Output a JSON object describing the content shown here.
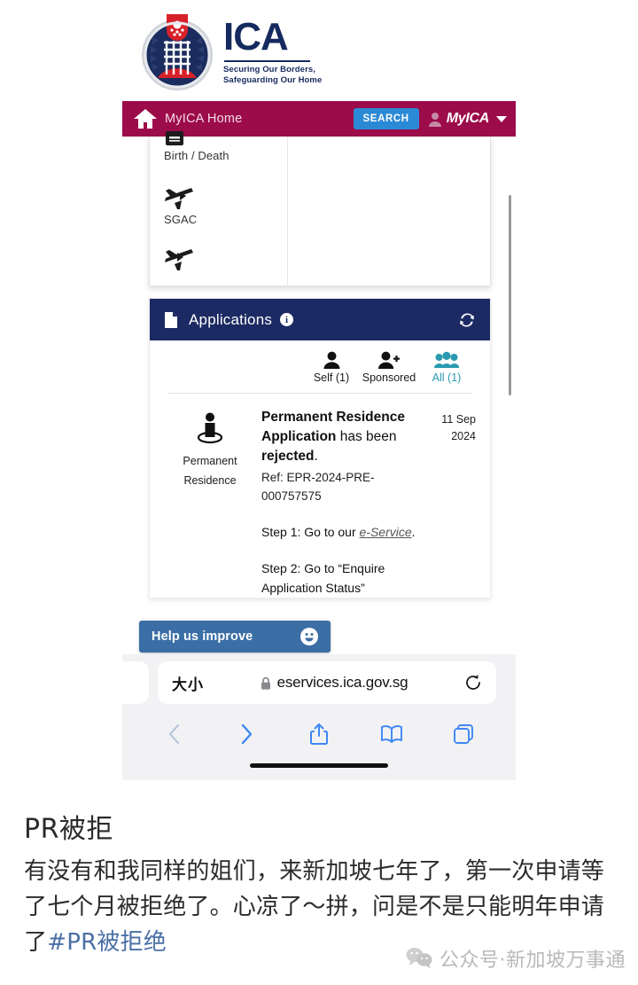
{
  "brand": {
    "name": "ICA",
    "tagline_line1": "Securing Our Borders,",
    "tagline_line2": "Safeguarding Our Home",
    "crest_alt": "ica-crest"
  },
  "navbar": {
    "home_label": "MyICA Home",
    "search_label": "SEARCH",
    "account_label": "MyICA",
    "bar_color": "#9c0b4a",
    "search_color": "#2b8ad6"
  },
  "menu": {
    "items": [
      {
        "label": "Birth / Death",
        "icon": "certificate-icon",
        "has_arrow": false
      },
      {
        "label": "SGAC",
        "icon": "airplane-icon",
        "has_arrow": true
      },
      {
        "label": "",
        "icon": "airplane-icon",
        "has_arrow": true
      }
    ]
  },
  "applications": {
    "header_title": "Applications",
    "info_char": "i",
    "header_color": "#1c2a63",
    "refresh_icon": "refresh-icon",
    "tabs": [
      {
        "label": "Self (1)",
        "icon": "person-icon",
        "active": false
      },
      {
        "label": "Sponsored",
        "icon": "person-add-icon",
        "active": false
      },
      {
        "label": "All (1)",
        "icon": "people-group-icon",
        "active": true
      }
    ],
    "active_color": "#2a9ab0",
    "entry": {
      "thumb_label_line1": "Permanent",
      "thumb_label_line2": "Residence",
      "thumb_icon": "person-location-icon",
      "statement_bold_1": "Permanent Residence Application",
      "statement_mid": " has been ",
      "statement_bold_2": "rejected",
      "statement_end": ".",
      "ref": "Ref: EPR-2024-PRE-000757575",
      "date_line1": "11 Sep",
      "date_line2": "2024",
      "step1_prefix": "Step 1: Go to our ",
      "step1_link": "e-Service",
      "step1_suffix": ".",
      "step2": "Step 2: Go to “Enquire Application Status”"
    }
  },
  "feedback": {
    "label": "Help us improve",
    "icon": "smiley-icon",
    "color": "#3a6ea5"
  },
  "safari": {
    "size_button": "大小",
    "lock_icon": "lock-icon",
    "url": "eservices.ica.gov.sg",
    "reload_icon": "reload-icon",
    "toolbar": [
      {
        "icon": "back-arrow-icon",
        "enabled": false
      },
      {
        "icon": "forward-arrow-icon",
        "enabled": true
      },
      {
        "icon": "share-icon",
        "enabled": true
      },
      {
        "icon": "bookmarks-icon",
        "enabled": true
      },
      {
        "icon": "tabs-icon",
        "enabled": true
      }
    ]
  },
  "post": {
    "title": "PR被拒",
    "body_line1": "有没有和我同样的姐们，来新加坡七年了，第一",
    "body_line2": "次申请等了七个月被拒绝了。心凉了～拼，问是",
    "body_line3_pre": "不是只能明年申请了",
    "body_hashtag": "#PR被拒绝",
    "watermark": "公众号·新加坡万事通",
    "watermark_icon": "wechat-icon"
  }
}
